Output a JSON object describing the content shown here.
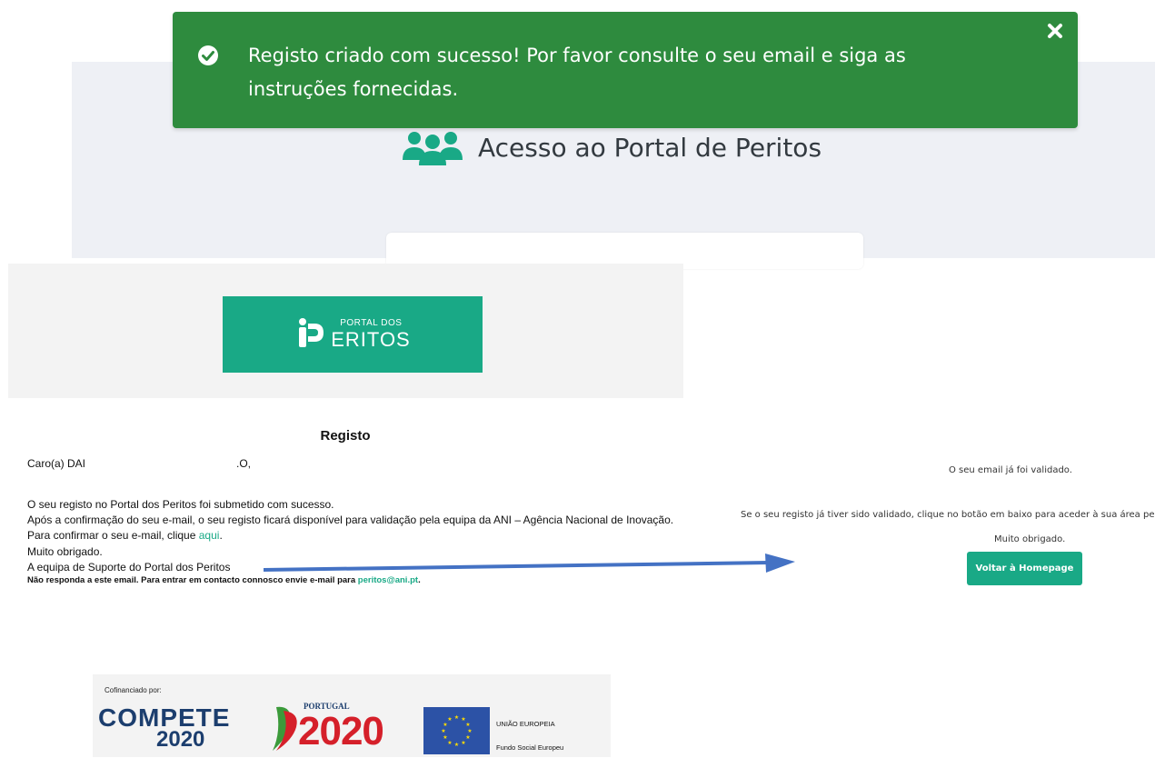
{
  "portal": {
    "heading": "Acesso ao Portal de Peritos",
    "icon": "users-group-icon"
  },
  "toast": {
    "message": "Registo criado com sucesso! Por favor consulte o seu email e siga as instruções fornecidas.",
    "icon": "check-circle-icon",
    "close_icon": "close-icon",
    "background": "#2e8b3e"
  },
  "email": {
    "logo_small": "PORTAL DOS",
    "logo_big": "ERITOS",
    "logo_color": "#19a986",
    "title": "Registo",
    "greeting_start": "Caro(a) DAI",
    "greeting_end": ".O,",
    "line1": "O seu registo no Portal dos Peritos foi submetido com sucesso.",
    "line2": "Após a confirmação do seu e-mail, o seu registo ficará disponível para validação pela equipa da ANI – Agência Nacional de Inovação.",
    "line3_prefix": "Para confirmar o seu e-mail, clique ",
    "line3_link": "aqui",
    "line3_suffix": ".",
    "line4": "Muito obrigado.",
    "line5": "A equipa de Suporte do Portal dos Peritos",
    "note_prefix": "Não responda a este email. Para entrar em contacto connosco envie e-mail para ",
    "note_email": "peritos@ani.pt",
    "note_suffix": "."
  },
  "footer": {
    "cofinanced": "Cofinanciado por:",
    "compete_word": "COMPETE",
    "compete_year": "2020",
    "portugal_label": "PORTUGAL",
    "portugal_year": "2020",
    "eu_line1": "UNIÃO EUROPEIA",
    "eu_line2": "Fundo Social Europeu"
  },
  "validation": {
    "validated": "O seu email já foi validado.",
    "instruction": "Se o seu registo já tiver sido validado, clique no botão em baixo para aceder à sua área pes",
    "thanks": "Muito obrigado.",
    "button": "Voltar à Homepage"
  },
  "annotation": {
    "arrow_color": "#4472c4"
  }
}
